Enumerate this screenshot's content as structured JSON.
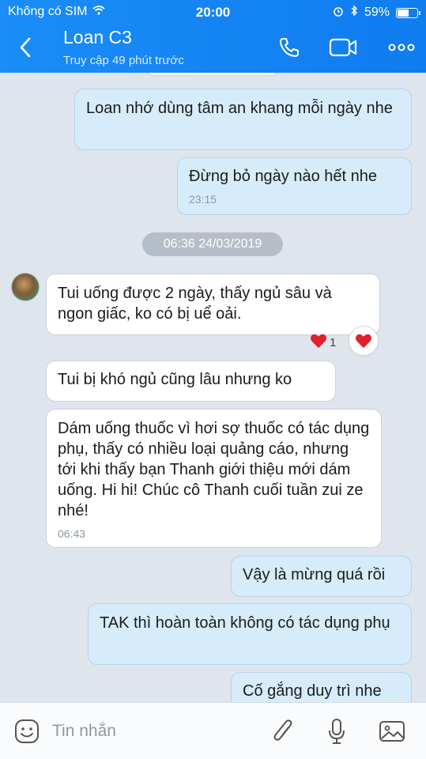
{
  "status_bar": {
    "carrier": "Không có SIM",
    "time": "20:00",
    "battery_text": "59%",
    "battery_level": 0.59
  },
  "header": {
    "contact_name": "Loan C3",
    "last_seen": "Truy cập 49 phút trước",
    "icons": [
      "back-icon",
      "phone-icon",
      "video-icon",
      "more-icon"
    ]
  },
  "messages": [
    {
      "id": "m1",
      "sender": "me",
      "text": "Loan nhớ dùng tâm an khang mỗi ngày nhe"
    },
    {
      "id": "m2",
      "sender": "me",
      "text": "Đừng bỏ ngày nào hết nhe",
      "time": "23:15"
    },
    {
      "id": "date",
      "type": "date",
      "text": "06:36 24/03/2019"
    },
    {
      "id": "m3",
      "sender": "other",
      "text": "Tui uống được 2 ngày, thấy ngủ sâu và ngon giấc, ko có bị uể oải.",
      "reaction_count": "1"
    },
    {
      "id": "m4",
      "sender": "other",
      "text": "Tui bị khó ngủ cũng lâu nhưng ko"
    },
    {
      "id": "m5",
      "sender": "other",
      "text": "Dám uống thuốc vì hơi sợ thuốc có tác dụng phụ, thấy có nhiều loại quảng cáo, nhưng tới khi thấy bạn Thanh giới thiệu mới dám uống. Hi hi! Chúc cô Thanh cuối tuần zui ze nhé!",
      "time": "06:43"
    },
    {
      "id": "m6",
      "sender": "me",
      "text": "Vậy là mừng quá rồi"
    },
    {
      "id": "m7",
      "sender": "me",
      "text": "TAK thì hoàn toàn không có tác dụng phụ"
    },
    {
      "id": "m8",
      "sender": "me",
      "text": "Cố gắng duy trì nhe"
    }
  ],
  "composer": {
    "placeholder": "Tin nhắn",
    "icons": [
      "sticker-icon",
      "attachment-icon",
      "microphone-icon",
      "image-icon"
    ]
  },
  "colors": {
    "header": "#1a8df7",
    "chat_bg": "#dfe5ec",
    "my_bubble": "#d6ecfb",
    "their_bubble": "#ffffff",
    "heart": "#e0202c"
  }
}
